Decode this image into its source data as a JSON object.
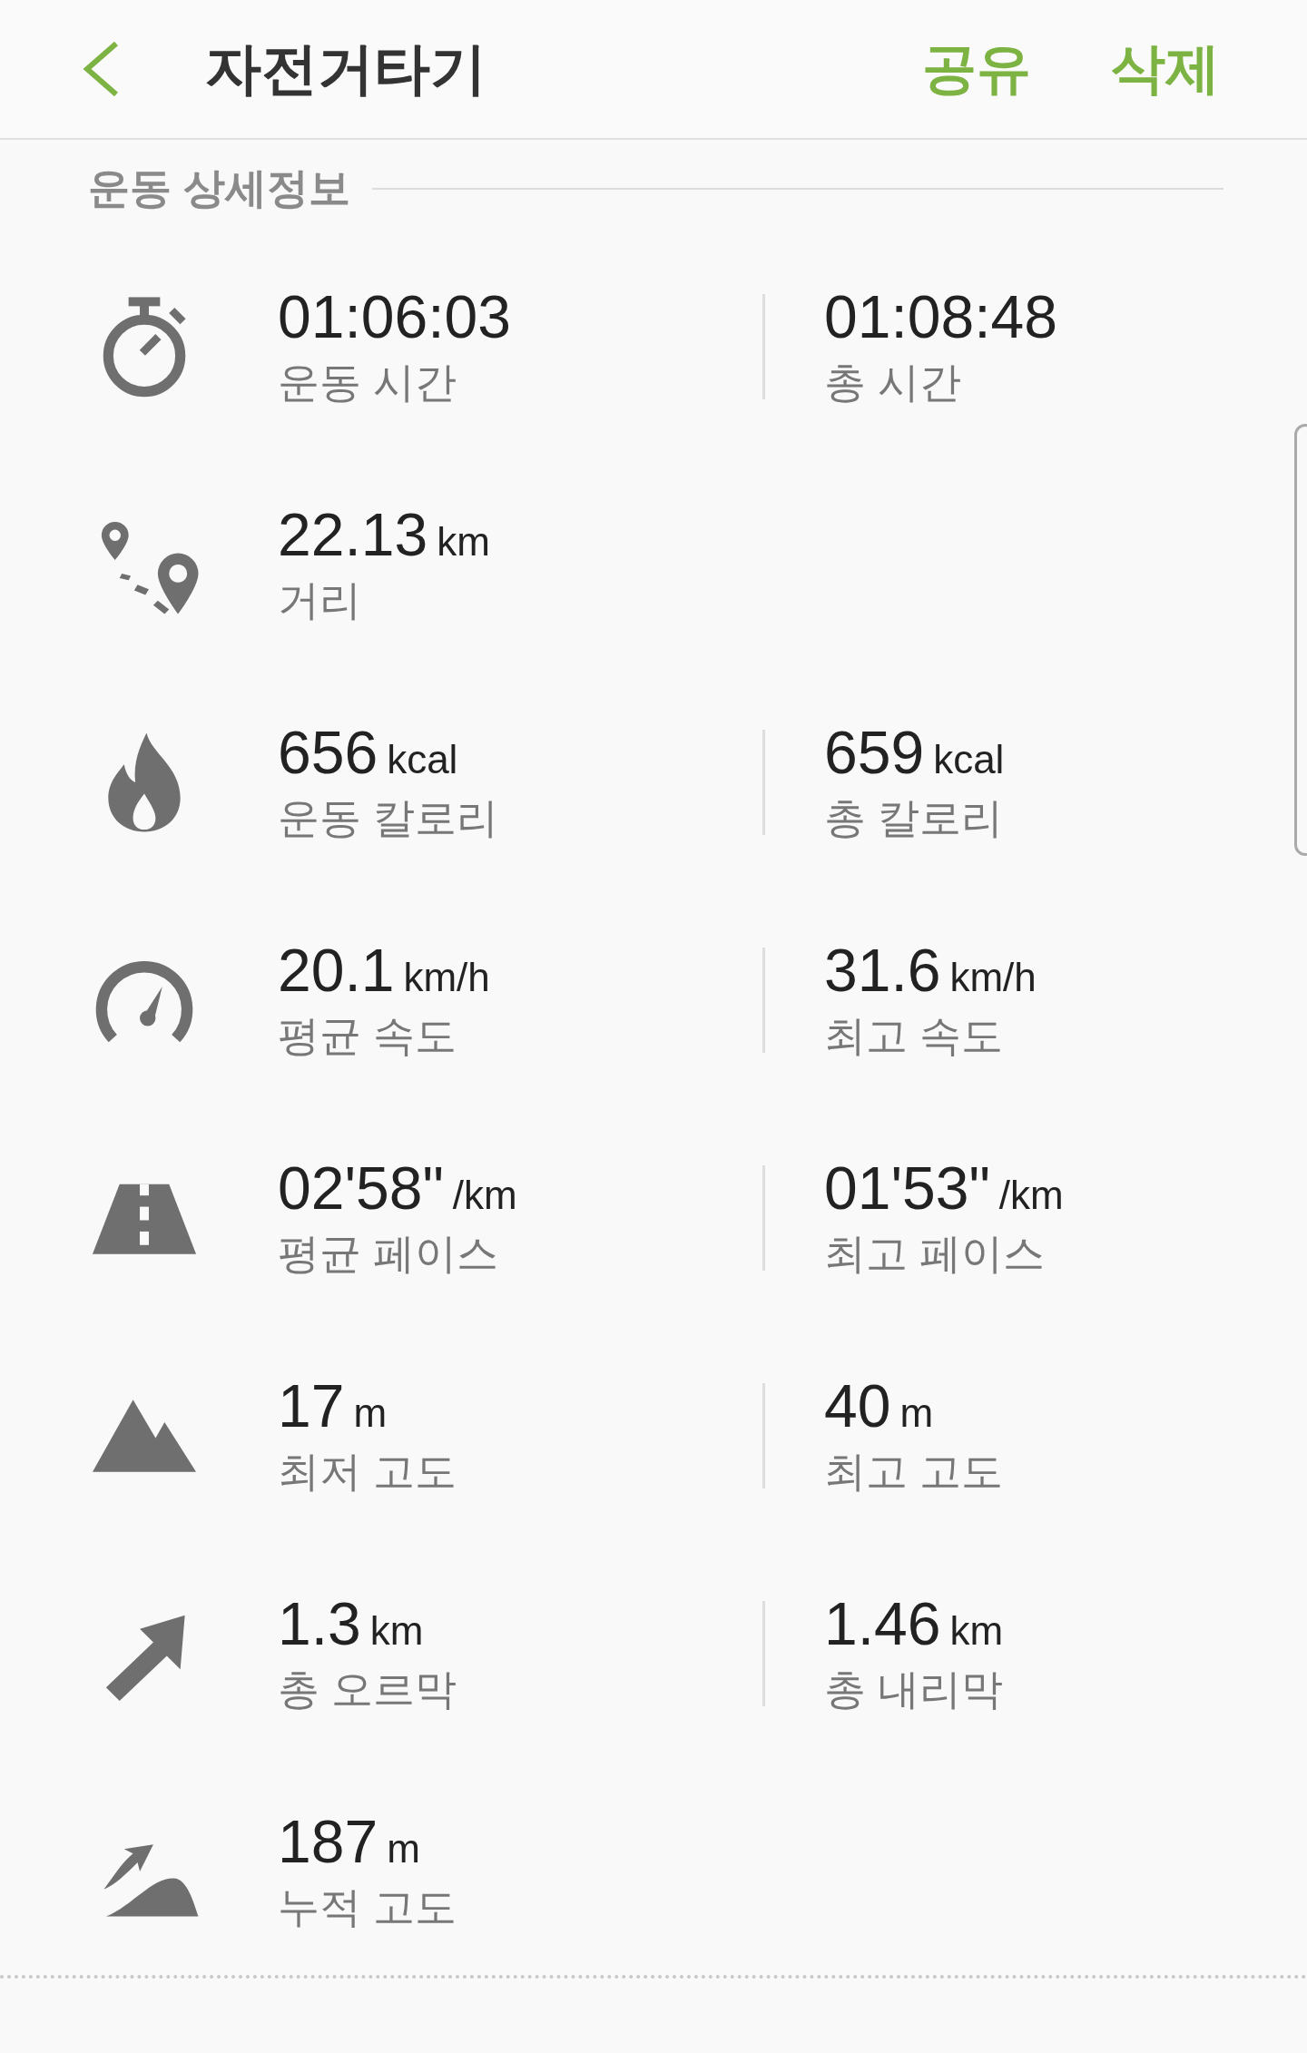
{
  "header": {
    "title": "자전거타기",
    "actions": [
      "공유",
      "삭제"
    ]
  },
  "section": {
    "title": "운동 상세정보"
  },
  "rows": [
    {
      "left": {
        "value": "01:06:03",
        "label": "운동 시간"
      },
      "right": {
        "value": "01:08:48",
        "label": "총 시간"
      }
    },
    {
      "left": {
        "value": "22.13",
        "unit": "km",
        "label": "거리"
      }
    },
    {
      "left": {
        "value": "656",
        "unit": "kcal",
        "label": "운동 칼로리"
      },
      "right": {
        "value": "659",
        "unit": "kcal",
        "label": "총 칼로리"
      }
    },
    {
      "left": {
        "value": "20.1",
        "unit": "km/h",
        "label": "평균 속도"
      },
      "right": {
        "value": "31.6",
        "unit": "km/h",
        "label": "최고 속도"
      }
    },
    {
      "left": {
        "value": "02'58\"",
        "unit": "/km",
        "label": "평균 페이스"
      },
      "right": {
        "value": "01'53\"",
        "unit": "/km",
        "label": "최고 페이스"
      }
    },
    {
      "left": {
        "value": "17",
        "unit": "m",
        "label": "최저 고도"
      },
      "right": {
        "value": "40",
        "unit": "m",
        "label": "최고 고도"
      }
    },
    {
      "left": {
        "value": "1.3",
        "unit": "km",
        "label": "총 오르막"
      },
      "right": {
        "value": "1.46",
        "unit": "km",
        "label": "총 내리막"
      }
    },
    {
      "left": {
        "value": "187",
        "unit": "m",
        "label": "누적 고도"
      }
    }
  ]
}
